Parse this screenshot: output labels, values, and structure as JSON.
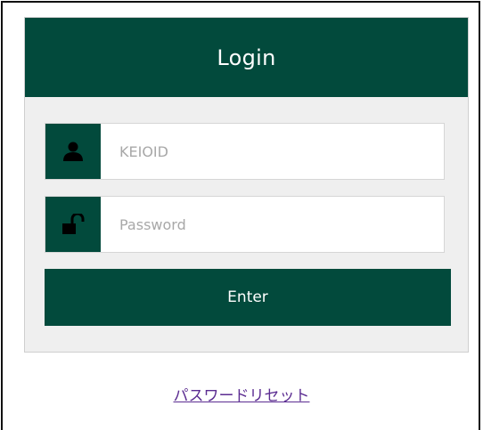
{
  "login": {
    "title": "Login",
    "username": {
      "value": "",
      "placeholder": "KEIOID",
      "icon": "user-icon"
    },
    "password": {
      "value": "",
      "placeholder": "Password",
      "icon": "unlock-icon"
    },
    "enter_label": "Enter"
  },
  "reset": {
    "link_text": "パスワードリセット"
  },
  "colors": {
    "brand": "#024a3c",
    "panel_bg": "#efefef",
    "link": "#5b2c91"
  }
}
